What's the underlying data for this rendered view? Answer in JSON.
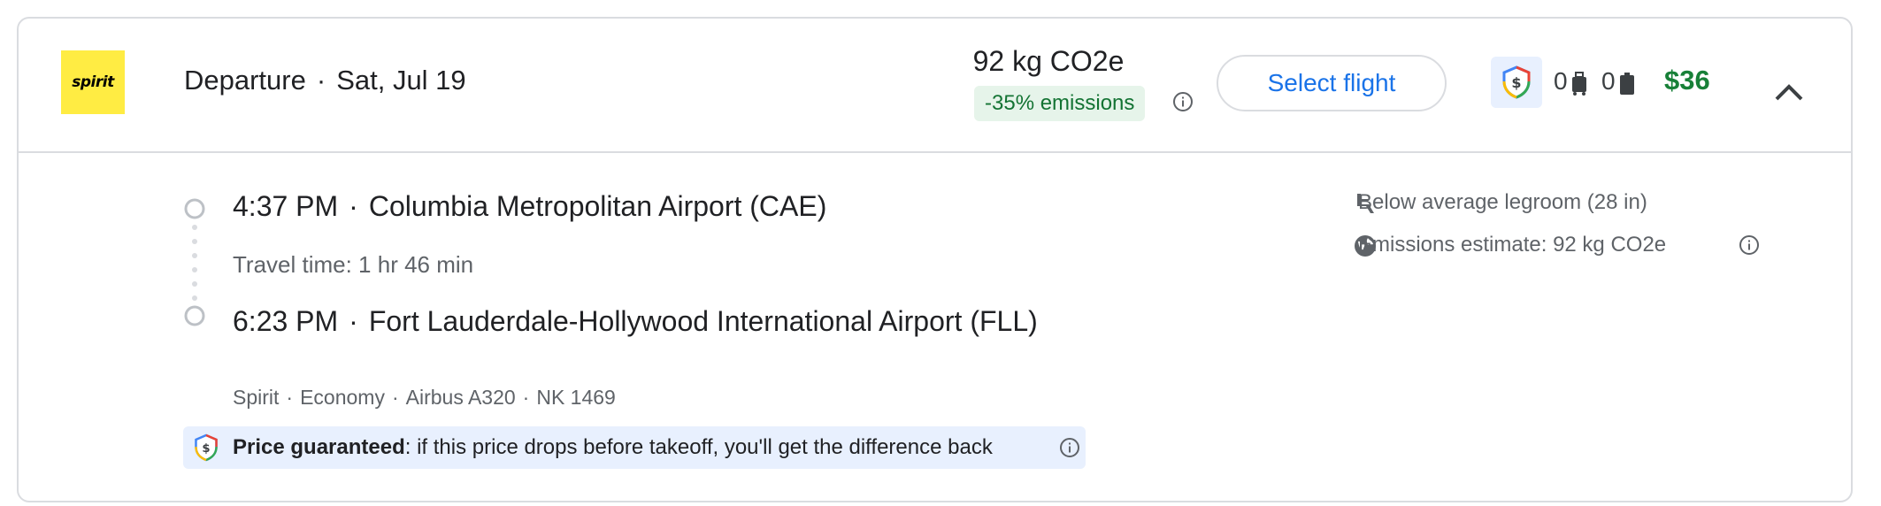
{
  "header": {
    "airline_logo_text": "spirit",
    "title": "Departure",
    "separator": "·",
    "date": "Sat, Jul 19",
    "emissions": "92 kg CO2e",
    "emissions_badge": "-35% emissions",
    "select_label": "Select flight",
    "carry_on_count": "0",
    "checked_bag_count": "0",
    "price": "$36",
    "colors": {
      "price": "#188038",
      "badge_bg": "#e6f4ea",
      "badge_text": "#137333",
      "accent": "#1a73e8",
      "logo_bg": "#ffec43"
    },
    "icons": [
      "shield-dollar-icon",
      "carry-on-bag-icon",
      "checked-bag-icon",
      "chevron-up-icon",
      "info-icon"
    ]
  },
  "itinerary": {
    "departure_time": "4:37 PM",
    "departure_airport": "Columbia Metropolitan Airport (CAE)",
    "travel_time": "Travel time: 1 hr 46 min",
    "arrival_time": "6:23 PM",
    "arrival_airport": "Fort Lauderdale-Hollywood International Airport (FLL)",
    "details": [
      "Spirit",
      "Economy",
      "Airbus A320",
      "NK 1469"
    ]
  },
  "guarantee": {
    "bold": "Price guaranteed",
    "rest": ": if this price drops before takeoff, you'll get the difference back"
  },
  "amenities": {
    "legroom": "Below average legroom (28 in)",
    "emissions_estimate": "Emissions estimate: 92 kg CO2e"
  }
}
